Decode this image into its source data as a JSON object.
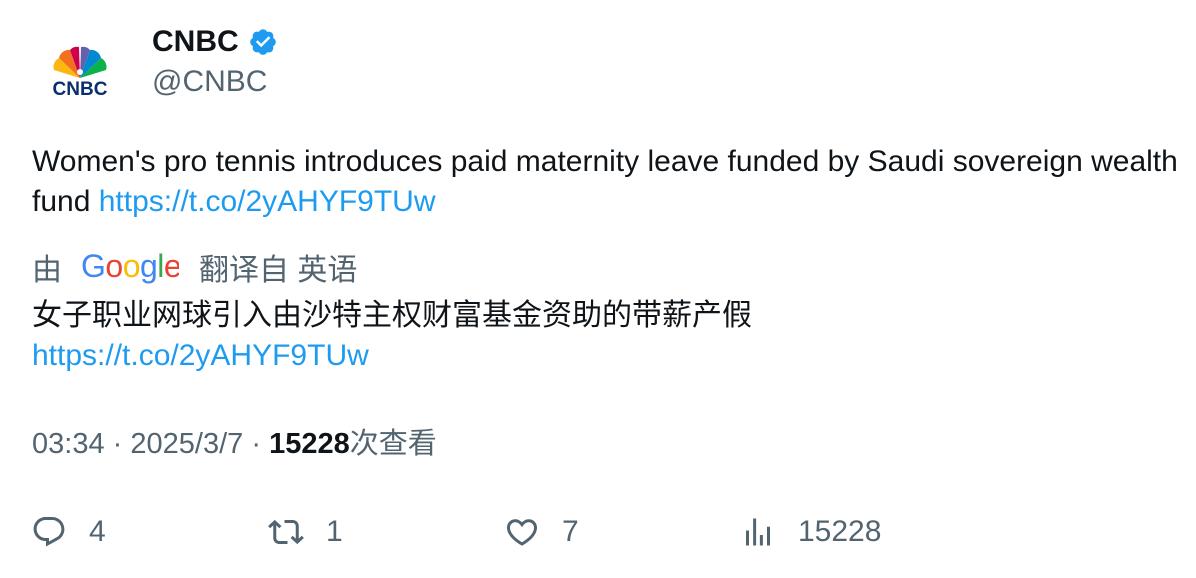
{
  "author": {
    "name": "CNBC",
    "handle": "@CNBC",
    "logo_text": "CNBC",
    "verified": true,
    "verified_color": "#1d9bf0"
  },
  "tweet": {
    "text": "Women's pro tennis introduces paid maternity leave funded by Saudi sovereign wealth fund",
    "link": "https://t.co/2yAHYF9TUw"
  },
  "translation": {
    "prefix": "由",
    "provider": "Google",
    "suffix": "翻译自 英语",
    "text": "女子职业网球引入由沙特主权财富基金资助的带薪产假",
    "link": "https://t.co/2yAHYF9TUw"
  },
  "meta": {
    "time": "03:34",
    "separator": "·",
    "date": "2025/3/7",
    "views_count": "15228",
    "views_label": "次查看"
  },
  "actions": {
    "replies": "4",
    "retweets": "1",
    "likes": "7",
    "views": "15228"
  },
  "colors": {
    "link": "#1d9bf0",
    "secondary": "#536471",
    "text": "#0f1419"
  },
  "icons": [
    "cnbc-peacock-logo",
    "verified-badge-icon",
    "google-logo",
    "reply-icon",
    "retweet-icon",
    "like-icon",
    "views-icon"
  ]
}
